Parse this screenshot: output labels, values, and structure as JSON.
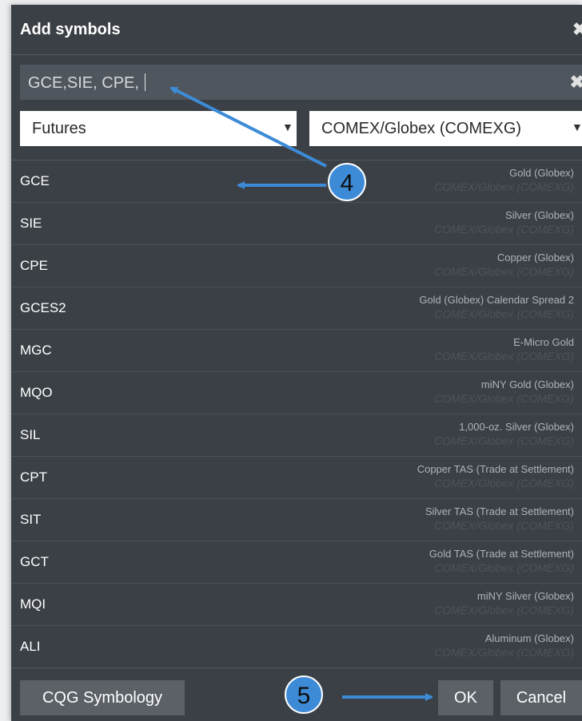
{
  "dialog": {
    "title": "Add symbols",
    "close_icon": "close-icon"
  },
  "search": {
    "value": "GCE,SIE, CPE, "
  },
  "filters": {
    "type_value": "Futures",
    "exchange_value": "COMEX/Globex (COMEXG)"
  },
  "symbols": [
    {
      "symbol": "GCE",
      "desc": "Gold (Globex)",
      "exchange": "COMEX/Globex (COMEXG)"
    },
    {
      "symbol": "SIE",
      "desc": "Silver (Globex)",
      "exchange": "COMEX/Globex (COMEXG)"
    },
    {
      "symbol": "CPE",
      "desc": "Copper (Globex)",
      "exchange": "COMEX/Globex (COMEXG)"
    },
    {
      "symbol": "GCES2",
      "desc": "Gold (Globex) Calendar Spread 2",
      "exchange": "COMEX/Globex (COMEXG)"
    },
    {
      "symbol": "MGC",
      "desc": "E-Micro Gold",
      "exchange": "COMEX/Globex (COMEXG)"
    },
    {
      "symbol": "MQO",
      "desc": "miNY Gold (Globex)",
      "exchange": "COMEX/Globex (COMEXG)"
    },
    {
      "symbol": "SIL",
      "desc": "1,000-oz. Silver (Globex)",
      "exchange": "COMEX/Globex (COMEXG)"
    },
    {
      "symbol": "CPT",
      "desc": "Copper TAS (Trade at Settlement)",
      "exchange": "COMEX/Globex (COMEXG)"
    },
    {
      "symbol": "SIT",
      "desc": "Silver TAS (Trade at Settlement)",
      "exchange": "COMEX/Globex (COMEXG)"
    },
    {
      "symbol": "GCT",
      "desc": "Gold TAS (Trade at Settlement)",
      "exchange": "COMEX/Globex (COMEXG)"
    },
    {
      "symbol": "MQI",
      "desc": "miNY Silver (Globex)",
      "exchange": "COMEX/Globex (COMEXG)"
    },
    {
      "symbol": "ALI",
      "desc": "Aluminum (Globex)",
      "exchange": "COMEX/Globex (COMEXG)"
    }
  ],
  "footer": {
    "symbology_label": "CQG Symbology",
    "ok_label": "OK",
    "cancel_label": "Cancel"
  },
  "annotations": {
    "step4": "4",
    "step5": "5",
    "arrow_color": "#3d8bd7"
  }
}
